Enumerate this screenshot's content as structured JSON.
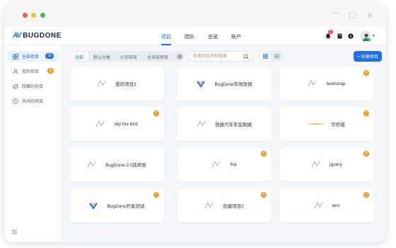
{
  "window": {
    "controls": [
      "minimize",
      "maximize",
      "close"
    ]
  },
  "brand": {
    "mark": "AV",
    "name": "BUGDONE",
    "accent": "#1f6fe5"
  },
  "nav": {
    "tabs": [
      {
        "label": "项目",
        "active": true
      },
      {
        "label": "团队",
        "active": false
      },
      {
        "label": "总览",
        "active": false
      },
      {
        "label": "账户",
        "active": false
      }
    ]
  },
  "header": {
    "notification_count": "1",
    "icons": [
      "bell-icon",
      "book-icon",
      "info-icon"
    ]
  },
  "sidebar": {
    "items": [
      {
        "label": "全部项目",
        "count": "23",
        "active": true,
        "icon": "grid-icon"
      },
      {
        "label": "我的项目",
        "count": "8",
        "active": false,
        "icon": "user-icon"
      },
      {
        "label": "隐藏的项目",
        "count": "",
        "active": false,
        "icon": "eye-off-icon"
      },
      {
        "label": "关闭的项目",
        "count": "",
        "active": false,
        "icon": "circle-close-icon"
      }
    ]
  },
  "toolbar": {
    "filters": [
      {
        "label": "全部",
        "active": true
      },
      {
        "label": "默认分类",
        "active": false
      },
      {
        "label": "公司项目",
        "active": false
      },
      {
        "label": "业务部项目",
        "active": false
      }
    ],
    "search_placeholder": "检索项目名称搜索",
    "create_label": "+ 创建项目"
  },
  "projects": [
    {
      "name": "我的项目2",
      "badge": "",
      "icon": "slash"
    },
    {
      "name": "BugDone市场营销",
      "badge": "",
      "icon": "logo"
    },
    {
      "name": "bootstrap",
      "badge": "8",
      "icon": "slash"
    },
    {
      "name": "sky the bird",
      "badge": "7",
      "icon": "slash"
    },
    {
      "name": "快捷汽车车型数据",
      "badge": "",
      "icon": "slash"
    },
    {
      "name": "华侨城",
      "badge": "7",
      "icon": "image"
    },
    {
      "name": "BugDone-2.0迭研发",
      "badge": "",
      "icon": "slash"
    },
    {
      "name": "fira",
      "badge": "8",
      "icon": "slash"
    },
    {
      "name": "jquery",
      "badge": "8",
      "icon": "slash"
    },
    {
      "name": "BugDone开发测试",
      "badge": "7",
      "icon": "logo"
    },
    {
      "name": "创建项目2",
      "badge": "8",
      "icon": "slash"
    },
    {
      "name": "test",
      "badge": "8",
      "icon": "slash"
    }
  ]
}
